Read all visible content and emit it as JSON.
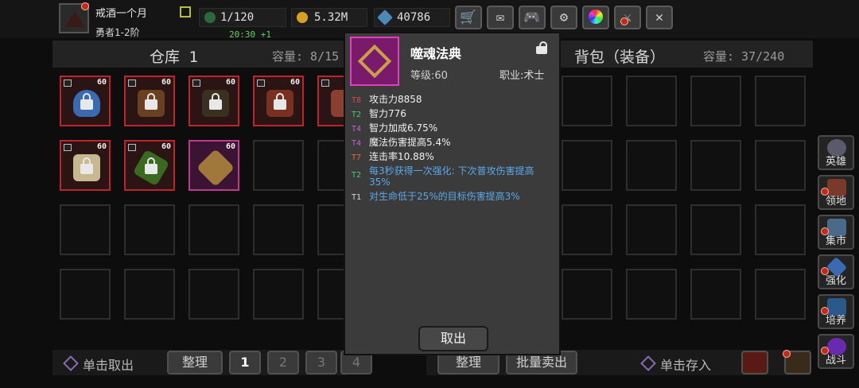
{
  "player": {
    "name": "戒酒一个月",
    "rank": "勇者1-2阶"
  },
  "stats": {
    "energy": "1/120",
    "gold": "5.32M",
    "gems": "40786",
    "timer": "20:30 +1"
  },
  "toolbar": {
    "icons": [
      "shop-cart-icon",
      "mail-icon",
      "gamepad-icon",
      "gear-icon",
      "color-wheel-icon",
      "sword-cross-icon",
      "tools-crossed-icon"
    ]
  },
  "warehouse": {
    "title": "仓库 1",
    "capacity": "容量: 8/15"
  },
  "backpack": {
    "title": "背包（装备）",
    "capacity": "容量: 37/240"
  },
  "warehouse_items": [
    {
      "level": "60",
      "style": "red"
    },
    {
      "level": "60",
      "style": "red"
    },
    {
      "level": "60",
      "style": "red"
    },
    {
      "level": "60",
      "style": "red"
    },
    {
      "level": "60",
      "style": "red"
    },
    {
      "level": "60",
      "style": "red"
    },
    {
      "level": "60",
      "style": "red"
    },
    {
      "level": "60",
      "style": "pink"
    }
  ],
  "sidebar": [
    {
      "label": "英雄"
    },
    {
      "label": "领地"
    },
    {
      "label": "集市"
    },
    {
      "label": "强化"
    },
    {
      "label": "培养"
    },
    {
      "label": "战斗"
    }
  ],
  "bottom_left": {
    "hint": "单击取出",
    "sort": "整理",
    "pages": [
      "1",
      "2",
      "3",
      "4"
    ]
  },
  "bottom_right": {
    "sort": "整理",
    "bulk_sell": "批量卖出",
    "hint": "单击存入"
  },
  "popup": {
    "name": "噬魂法典",
    "level": "等级:60",
    "class": "职业:术士",
    "attributes": [
      {
        "tier": "T8",
        "text": "攻击力8858",
        "kind": "stat"
      },
      {
        "tier": "T2",
        "text": "智力776",
        "kind": "stat"
      },
      {
        "tier": "T4",
        "text": "智力加成6.75%",
        "kind": "stat"
      },
      {
        "tier": "T4",
        "text": "魔法伤害提高5.4%",
        "kind": "stat"
      },
      {
        "tier": "T7",
        "text": "连击率10.88%",
        "kind": "stat"
      },
      {
        "tier": "T2",
        "text": "每3秒获得一次强化: 下次普攻伤害提高35%",
        "kind": "desc"
      },
      {
        "tier": "T1",
        "text": "对生命低于25%的目标伤害提高3%",
        "kind": "desc"
      }
    ],
    "cancel": "取出"
  },
  "colors": {
    "tier_T8": "#e04848",
    "tier_T7": "#e06a3a",
    "tier_T4": "#c060d0",
    "tier_T2": "#4ac87a",
    "tier_T1": "#d8d8d8"
  }
}
